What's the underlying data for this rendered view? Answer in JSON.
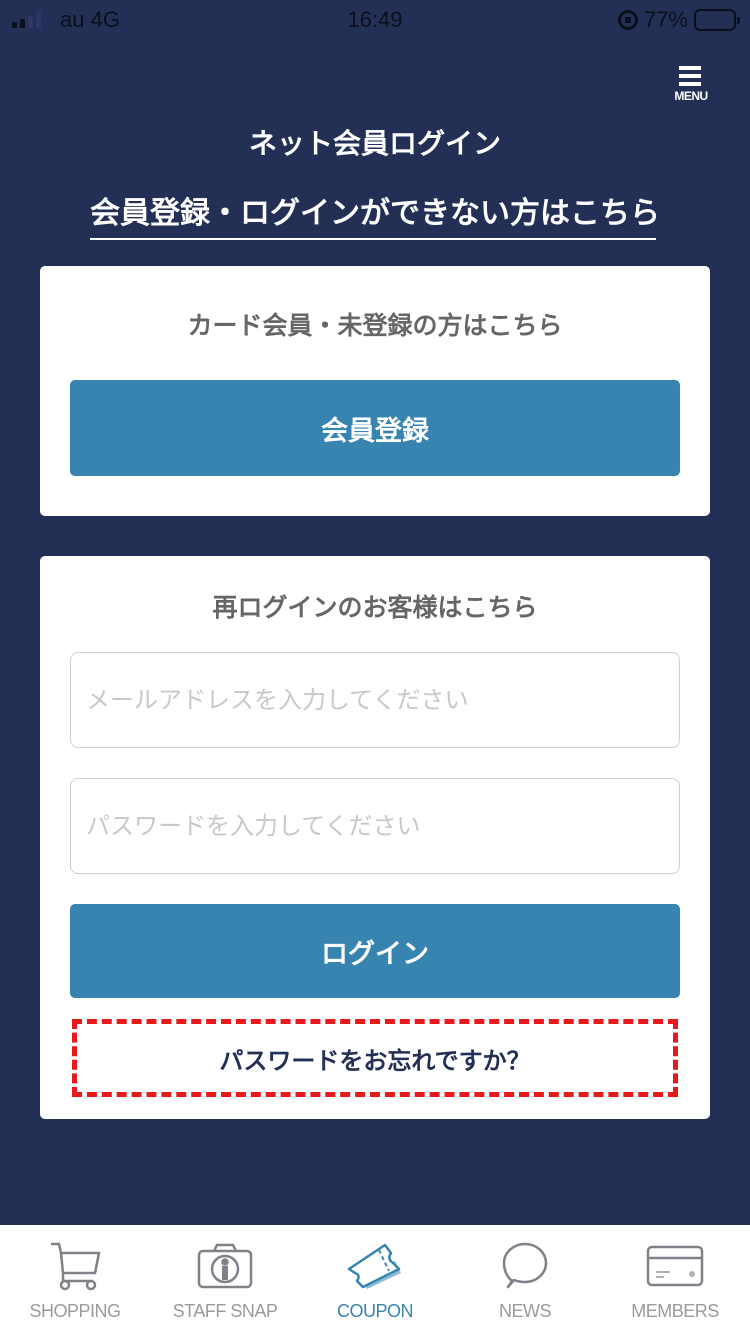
{
  "status_bar": {
    "carrier": "au 4G",
    "time": "16:49",
    "battery_percent": "77%",
    "battery_level": 0.77,
    "signal_bars": 2
  },
  "header": {
    "menu_label": "MENU",
    "menu_icon": "hamburger-icon",
    "title": "ネット会員ログイン",
    "help_link": "会員登録・ログインができない方はこちら"
  },
  "register_card": {
    "heading": "カード会員・未登録の方はこちら",
    "button_label": "会員登録"
  },
  "login_card": {
    "heading": "再ログインのお客様はこちら",
    "email_placeholder": "メールアドレスを入力してください",
    "email_value": "",
    "password_placeholder": "パスワードを入力してください",
    "password_value": "",
    "login_button_label": "ログイン",
    "forgot_password_label": "パスワードをお忘れですか？"
  },
  "tab_bar": {
    "active": "coupon",
    "items": [
      {
        "id": "shopping",
        "label": "SHOPPING",
        "icon": "cart-icon"
      },
      {
        "id": "staff_snap",
        "label": "STAFF SNAP",
        "icon": "camera-icon"
      },
      {
        "id": "coupon",
        "label": "COUPON",
        "icon": "ticket-icon"
      },
      {
        "id": "news",
        "label": "NEWS",
        "icon": "speech-bubble-icon"
      },
      {
        "id": "members",
        "label": "MEMBERS",
        "icon": "card-icon"
      }
    ]
  },
  "colors": {
    "background": "#232f55",
    "primary_button": "#3784b0",
    "highlight_dash": "#e8191c",
    "tab_inactive": "#9a9b9f",
    "tab_active": "#3784b0"
  }
}
